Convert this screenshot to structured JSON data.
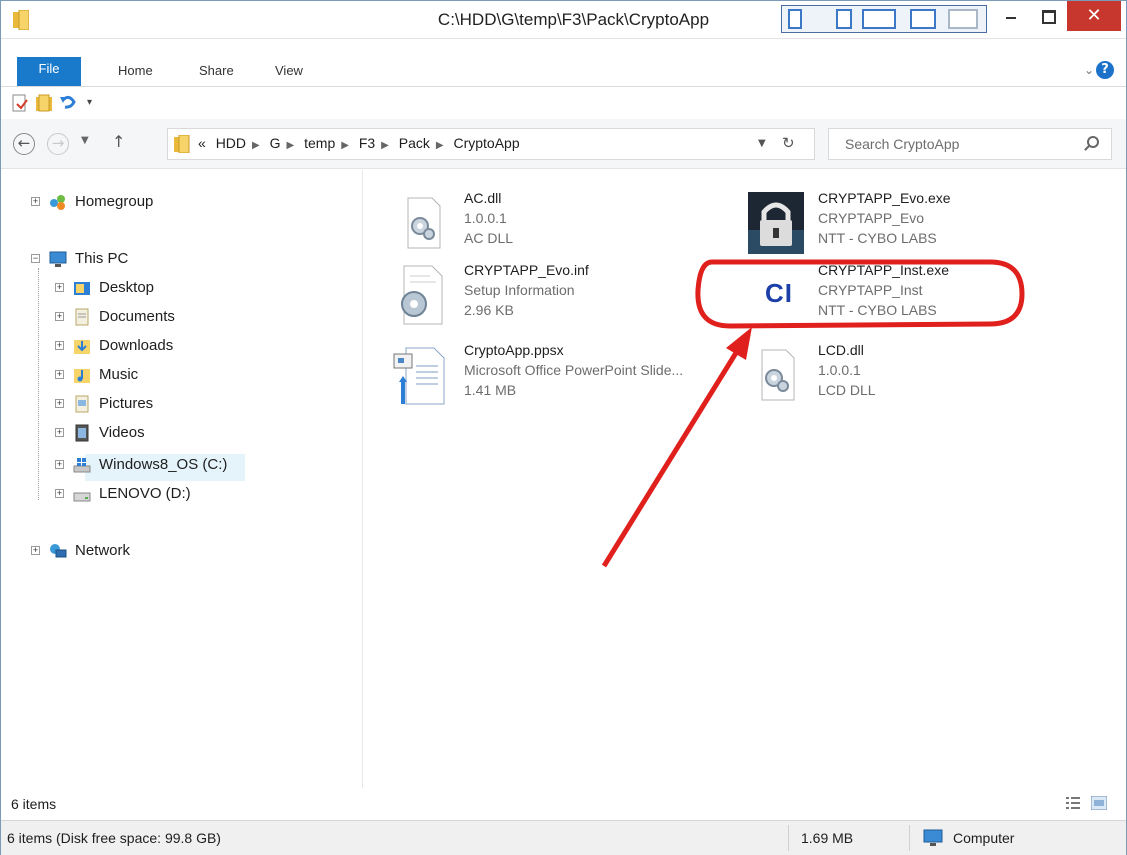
{
  "window": {
    "title": "C:\\HDD\\G\\temp\\F3\\Pack\\CryptoApp",
    "close_glyph": "✕"
  },
  "ribbon": {
    "tabs": [
      "File",
      "Home",
      "Share",
      "View"
    ],
    "help": "?"
  },
  "address": {
    "overflow": "«",
    "crumbs": [
      "HDD",
      "G",
      "temp",
      "F3",
      "Pack",
      "CryptoApp"
    ],
    "search_placeholder": "Search CryptoApp"
  },
  "nav": {
    "homegroup": "Homegroup",
    "this_pc": "This PC",
    "children": [
      "Desktop",
      "Documents",
      "Downloads",
      "Music",
      "Pictures",
      "Videos",
      "Windows8_OS (C:)",
      "LENOVO (D:)"
    ],
    "network": "Network"
  },
  "files": [
    {
      "name": "AC.dll",
      "line1": "1.0.0.1",
      "line2": "AC DLL",
      "icon": "dll-gear-icon"
    },
    {
      "name": "CRYPTAPP_Evo.exe",
      "line1": "CRYPTAPP_Evo",
      "line2": "NTT - CYBO LABS",
      "icon": "padlock-app-icon"
    },
    {
      "name": "CRYPTAPP_Evo.inf",
      "line1": "Setup Information",
      "line2": "2.96 KB",
      "icon": "setup-info-icon"
    },
    {
      "name": "CRYPTAPP_Inst.exe",
      "line1": "CRYPTAPP_Inst",
      "line2": "NTT - CYBO LABS",
      "icon": "ci-logo-icon",
      "icon_text": "CI"
    },
    {
      "name": "CryptoApp.ppsx",
      "line1": "Microsoft Office PowerPoint Slide...",
      "line2": "1.41 MB",
      "icon": "powerpoint-show-icon"
    },
    {
      "name": "LCD.dll",
      "line1": "1.0.0.1",
      "line2": "LCD DLL",
      "icon": "dll-gear-icon"
    }
  ],
  "status": {
    "item_count": "6 items",
    "bottom_left": "6 items (Disk free space: 99.8 GB)",
    "size": "1.69 MB",
    "location": "Computer"
  },
  "colors": {
    "accent": "#1979ca",
    "annotation": "#e0201c",
    "close": "#c7372d"
  }
}
